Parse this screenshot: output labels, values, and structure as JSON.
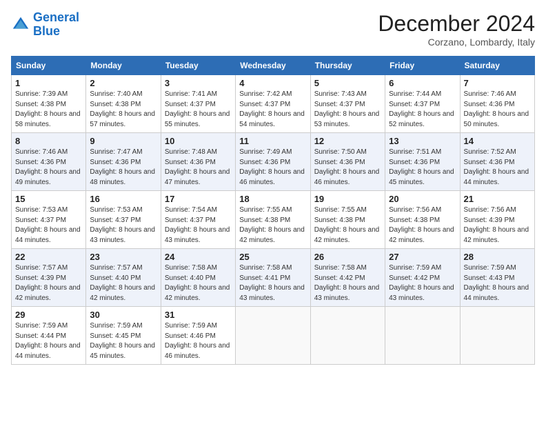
{
  "logo": {
    "line1": "General",
    "line2": "Blue"
  },
  "title": "December 2024",
  "location": "Corzano, Lombardy, Italy",
  "weekdays": [
    "Sunday",
    "Monday",
    "Tuesday",
    "Wednesday",
    "Thursday",
    "Friday",
    "Saturday"
  ],
  "weeks": [
    [
      {
        "day": "1",
        "sunrise": "7:39 AM",
        "sunset": "4:38 PM",
        "daylight": "8 hours and 58 minutes."
      },
      {
        "day": "2",
        "sunrise": "7:40 AM",
        "sunset": "4:38 PM",
        "daylight": "8 hours and 57 minutes."
      },
      {
        "day": "3",
        "sunrise": "7:41 AM",
        "sunset": "4:37 PM",
        "daylight": "8 hours and 55 minutes."
      },
      {
        "day": "4",
        "sunrise": "7:42 AM",
        "sunset": "4:37 PM",
        "daylight": "8 hours and 54 minutes."
      },
      {
        "day": "5",
        "sunrise": "7:43 AM",
        "sunset": "4:37 PM",
        "daylight": "8 hours and 53 minutes."
      },
      {
        "day": "6",
        "sunrise": "7:44 AM",
        "sunset": "4:37 PM",
        "daylight": "8 hours and 52 minutes."
      },
      {
        "day": "7",
        "sunrise": "7:46 AM",
        "sunset": "4:36 PM",
        "daylight": "8 hours and 50 minutes."
      }
    ],
    [
      {
        "day": "8",
        "sunrise": "7:46 AM",
        "sunset": "4:36 PM",
        "daylight": "8 hours and 49 minutes."
      },
      {
        "day": "9",
        "sunrise": "7:47 AM",
        "sunset": "4:36 PM",
        "daylight": "8 hours and 48 minutes."
      },
      {
        "day": "10",
        "sunrise": "7:48 AM",
        "sunset": "4:36 PM",
        "daylight": "8 hours and 47 minutes."
      },
      {
        "day": "11",
        "sunrise": "7:49 AM",
        "sunset": "4:36 PM",
        "daylight": "8 hours and 46 minutes."
      },
      {
        "day": "12",
        "sunrise": "7:50 AM",
        "sunset": "4:36 PM",
        "daylight": "8 hours and 46 minutes."
      },
      {
        "day": "13",
        "sunrise": "7:51 AM",
        "sunset": "4:36 PM",
        "daylight": "8 hours and 45 minutes."
      },
      {
        "day": "14",
        "sunrise": "7:52 AM",
        "sunset": "4:36 PM",
        "daylight": "8 hours and 44 minutes."
      }
    ],
    [
      {
        "day": "15",
        "sunrise": "7:53 AM",
        "sunset": "4:37 PM",
        "daylight": "8 hours and 44 minutes."
      },
      {
        "day": "16",
        "sunrise": "7:53 AM",
        "sunset": "4:37 PM",
        "daylight": "8 hours and 43 minutes."
      },
      {
        "day": "17",
        "sunrise": "7:54 AM",
        "sunset": "4:37 PM",
        "daylight": "8 hours and 43 minutes."
      },
      {
        "day": "18",
        "sunrise": "7:55 AM",
        "sunset": "4:38 PM",
        "daylight": "8 hours and 42 minutes."
      },
      {
        "day": "19",
        "sunrise": "7:55 AM",
        "sunset": "4:38 PM",
        "daylight": "8 hours and 42 minutes."
      },
      {
        "day": "20",
        "sunrise": "7:56 AM",
        "sunset": "4:38 PM",
        "daylight": "8 hours and 42 minutes."
      },
      {
        "day": "21",
        "sunrise": "7:56 AM",
        "sunset": "4:39 PM",
        "daylight": "8 hours and 42 minutes."
      }
    ],
    [
      {
        "day": "22",
        "sunrise": "7:57 AM",
        "sunset": "4:39 PM",
        "daylight": "8 hours and 42 minutes."
      },
      {
        "day": "23",
        "sunrise": "7:57 AM",
        "sunset": "4:40 PM",
        "daylight": "8 hours and 42 minutes."
      },
      {
        "day": "24",
        "sunrise": "7:58 AM",
        "sunset": "4:40 PM",
        "daylight": "8 hours and 42 minutes."
      },
      {
        "day": "25",
        "sunrise": "7:58 AM",
        "sunset": "4:41 PM",
        "daylight": "8 hours and 43 minutes."
      },
      {
        "day": "26",
        "sunrise": "7:58 AM",
        "sunset": "4:42 PM",
        "daylight": "8 hours and 43 minutes."
      },
      {
        "day": "27",
        "sunrise": "7:59 AM",
        "sunset": "4:42 PM",
        "daylight": "8 hours and 43 minutes."
      },
      {
        "day": "28",
        "sunrise": "7:59 AM",
        "sunset": "4:43 PM",
        "daylight": "8 hours and 44 minutes."
      }
    ],
    [
      {
        "day": "29",
        "sunrise": "7:59 AM",
        "sunset": "4:44 PM",
        "daylight": "8 hours and 44 minutes."
      },
      {
        "day": "30",
        "sunrise": "7:59 AM",
        "sunset": "4:45 PM",
        "daylight": "8 hours and 45 minutes."
      },
      {
        "day": "31",
        "sunrise": "7:59 AM",
        "sunset": "4:46 PM",
        "daylight": "8 hours and 46 minutes."
      },
      null,
      null,
      null,
      null
    ]
  ]
}
